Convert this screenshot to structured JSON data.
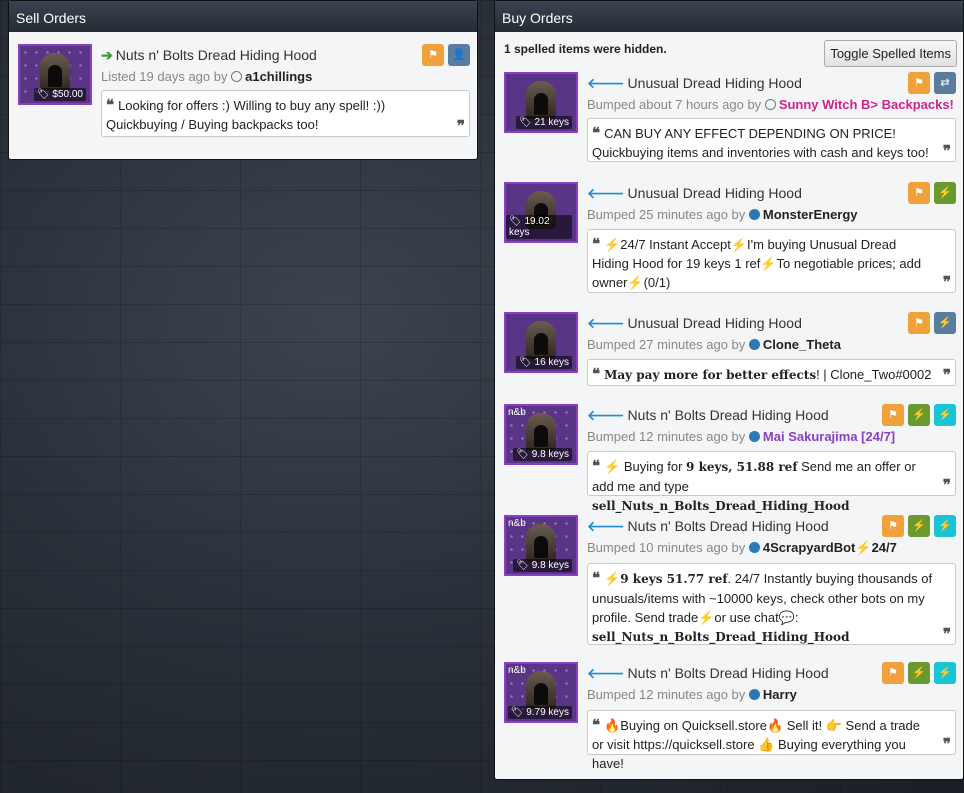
{
  "sell": {
    "header": "Sell Orders",
    "listing": {
      "title": "Nuts n' Bolts Dread Hiding Hood",
      "meta_prefix": "Listed 19 days ago by",
      "user": "a1chillings",
      "price": "$50.00",
      "quote": "Looking for offers :) Willing to buy any spell! :)) Quickbuying / Buying backpacks too!"
    }
  },
  "buy": {
    "header": "Buy Orders",
    "hidden_note": "1 spelled items were hidden.",
    "toggle_label": "Toggle Spelled Items",
    "listings": [
      {
        "title": "Unusual Dread Hiding Hood",
        "meta": "Bumped about 7 hours ago by",
        "user": "Sunny Witch B> Backpacks!",
        "price": "21 keys",
        "quote": "CAN BUY ANY EFFECT DEPENDING ON PRICE! Quickbuying items and inventories with cash and keys too!"
      },
      {
        "title": "Unusual Dread Hiding Hood",
        "meta": "Bumped 25 minutes ago by",
        "user": "MonsterEnergy",
        "price": "19.02 keys",
        "quote": "⚡24/7 Instant Accept⚡I'm buying Unusual Dread Hiding Hood for 19 keys 1 ref⚡To negotiable prices; add owner⚡(0/1)"
      },
      {
        "title": "Unusual Dread Hiding Hood",
        "meta": "Bumped 27 minutes ago by",
        "user": "Clone_Theta",
        "price": "16 keys",
        "quote_bold": "May pay more for better effects",
        "quote_rest": "! | Clone_Two#0002"
      },
      {
        "title": "Nuts n' Bolts Dread Hiding Hood",
        "meta": "Bumped 12 minutes ago by",
        "user": "Mai Sakurajima [24/7]",
        "price": "9.8 keys",
        "tag": "n&b",
        "quote_a": "⚡ Buying for",
        "quote_b": "9 keys, 51.88 ref",
        "quote_c": "Send me an offer or add me and type",
        "quote_d": "sell_Nuts_n_Bolts_Dread_Hiding_Hood"
      },
      {
        "title": "Nuts n' Bolts Dread Hiding Hood",
        "meta": "Bumped 10 minutes ago by",
        "user": "4ScrapyardBot⚡24/7",
        "price": "9.8 keys",
        "tag": "n&b",
        "quote_a": "⚡",
        "quote_b": "9 keys 51.77 ref",
        "quote_c": ". 24/7 Instantly buying thousands of unusuals/items with ~10000 keys, check other bots on my profile. Send trade⚡or use chat💬:",
        "quote_d": "sell_Nuts_n_Bolts_Dread_Hiding_Hood"
      },
      {
        "title": "Nuts n' Bolts Dread Hiding Hood",
        "meta": "Bumped 12 minutes ago by",
        "user": "Harry",
        "price": "9.79 keys",
        "tag": "n&b",
        "quote": "🔥Buying on Quicksell.store🔥 Sell it! 👉 Send a trade or visit https://quicksell.store 👍 Buying everything you have!"
      }
    ]
  },
  "icons": {
    "open_quote": "❝",
    "close_quote": "❞",
    "tag_icon": "🏷",
    "arrow_right": "➔",
    "arrow_left": "🡐",
    "flag": "⚑",
    "add_user": "👤",
    "swap": "⇄",
    "bolt": "⚡"
  },
  "colors": {
    "flag": "#f0a13a",
    "slate": "#5a7c9e",
    "green": "#6a9a2e",
    "cyan": "#18c4d6",
    "item_border": "#8a3fc4",
    "sell_arrow": "#3f9a33",
    "buy_arrow": "#1e8ed1",
    "pink_user": "#d0238c",
    "purple_user": "#8b3fc2"
  }
}
